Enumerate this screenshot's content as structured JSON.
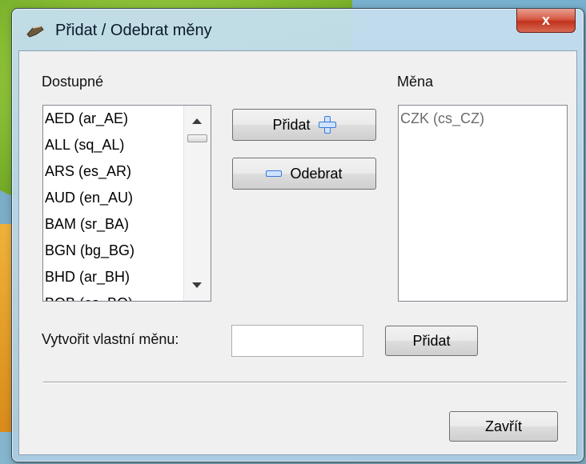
{
  "window": {
    "title": "Přidat / Odebrat měny",
    "close_label": "x"
  },
  "available": {
    "label": "Dostupné",
    "items": [
      "AED (ar_AE)",
      "ALL (sq_AL)",
      "ARS (es_AR)",
      "AUD (en_AU)",
      "BAM (sr_BA)",
      "BGN (bg_BG)",
      "BHD (ar_BH)",
      "BOB (es_BO)"
    ]
  },
  "selected": {
    "label": "Měna",
    "items": [
      "CZK (cs_CZ)"
    ]
  },
  "buttons": {
    "add": "Přidat",
    "remove": "Odebrat",
    "add_custom": "Přidat",
    "close": "Zavřít"
  },
  "custom": {
    "label": "Vytvořit vlastní měnu:",
    "value": ""
  },
  "icons": {
    "title": "app-icon",
    "add": "plus-icon",
    "remove": "minus-icon"
  },
  "colors": {
    "close_button": "#c2321d",
    "selected_item_text": "#6b6b6b",
    "icon_blue": "#3a78d4"
  }
}
